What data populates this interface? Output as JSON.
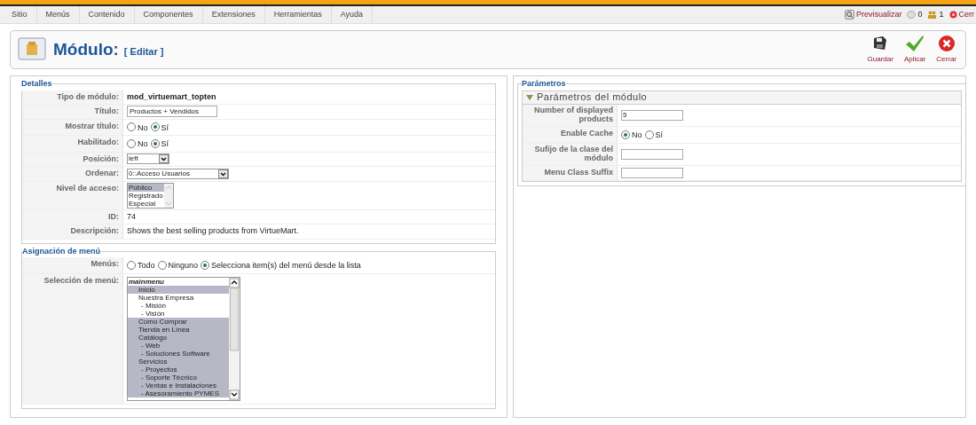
{
  "menu_bar": {
    "items": [
      "Sitio",
      "Menús",
      "Contenido",
      "Componentes",
      "Extensiones",
      "Herramientas",
      "Ayuda"
    ]
  },
  "status": {
    "preview": "Previsualizar",
    "messages": "0",
    "users": "1",
    "logout": "Cerr"
  },
  "header": {
    "title": "Módulo:",
    "subtitle": "[ Editar ]",
    "toolbar": [
      {
        "kind": "save",
        "label": "Guardar"
      },
      {
        "kind": "apply",
        "label": "Aplicar"
      },
      {
        "kind": "close",
        "label": "Cerrar"
      }
    ]
  },
  "details": {
    "legend": "Detalles",
    "rows": [
      {
        "kind": "text",
        "label": "Tipo de módulo:",
        "value": "mod_virtuemart_topten",
        "bold": true
      },
      {
        "kind": "input",
        "label": "Título:",
        "value": "Productos + Vendidos",
        "wide": true
      },
      {
        "kind": "radio",
        "label": "Mostrar título:",
        "options": [
          {
            "label": "No",
            "selected": false
          },
          {
            "label": "Sí",
            "selected": true
          }
        ]
      },
      {
        "kind": "radio",
        "label": "Habilitado:",
        "options": [
          {
            "label": "No",
            "selected": false
          },
          {
            "label": "Sí",
            "selected": true
          }
        ]
      },
      {
        "kind": "select",
        "label": "Posición:",
        "value": "left",
        "wide": false
      },
      {
        "kind": "select",
        "label": "Ordenar:",
        "value": "0::Acceso Usuarios",
        "wide": true
      },
      {
        "kind": "listbox",
        "label": "Nivel de acceso:",
        "items": [
          {
            "label": "Público",
            "selected": true
          },
          {
            "label": "Registrado",
            "selected": false
          },
          {
            "label": "Especial",
            "selected": false
          }
        ]
      },
      {
        "kind": "text",
        "label": "ID:",
        "value": "74",
        "bold": false
      },
      {
        "kind": "text",
        "label": "Descripción:",
        "value": "Shows the best selling products from VirtueMart.",
        "bold": false
      }
    ]
  },
  "menu_assignment": {
    "legend": "Asignación de menú",
    "menus_label": "Menús:",
    "menus_options": [
      {
        "label": "Todo",
        "selected": false
      },
      {
        "label": "Ninguno",
        "selected": false
      },
      {
        "label": "Selecciona item(s) del menú desde la lista",
        "selected": true
      }
    ],
    "selection_label": "Selección de menú:",
    "group": "mainmenu",
    "items": [
      {
        "label": "Inicio",
        "selected": true
      },
      {
        "label": "Nuestra Empresa",
        "selected": false,
        "children": [
          {
            "label": "- Misión",
            "selected": false
          },
          {
            "label": "- Visión",
            "selected": false
          }
        ]
      },
      {
        "label": "Como Comprar",
        "selected": true
      },
      {
        "label": "Tienda en Línea",
        "selected": true
      },
      {
        "label": "Catálogo",
        "selected": true,
        "children": [
          {
            "label": "- Web",
            "selected": true
          },
          {
            "label": "- Soluciones Software",
            "selected": true
          }
        ]
      },
      {
        "label": "Servicios",
        "selected": true,
        "children": [
          {
            "label": "- Proyectos",
            "selected": true
          },
          {
            "label": "- Soporte Técnico",
            "selected": true
          },
          {
            "label": "- Ventas e Instalaciones",
            "selected": true
          },
          {
            "label": "- Asesoramiento PYMES",
            "selected": true
          }
        ]
      }
    ]
  },
  "parameters": {
    "legend": "Parámetros",
    "section": {
      "title": "Parámetros del módulo",
      "expanded": true
    },
    "rows": [
      {
        "kind": "input",
        "label": "Number of displayed products",
        "value": "5"
      },
      {
        "kind": "radio",
        "label": "Enable Cache",
        "options": [
          {
            "label": "No",
            "selected": true
          },
          {
            "label": "Sí",
            "selected": false
          }
        ]
      },
      {
        "kind": "input",
        "label": "Sufijo de la clase del módulo",
        "value": ""
      },
      {
        "kind": "input",
        "label": "Menu Class Suffix",
        "value": ""
      }
    ]
  }
}
